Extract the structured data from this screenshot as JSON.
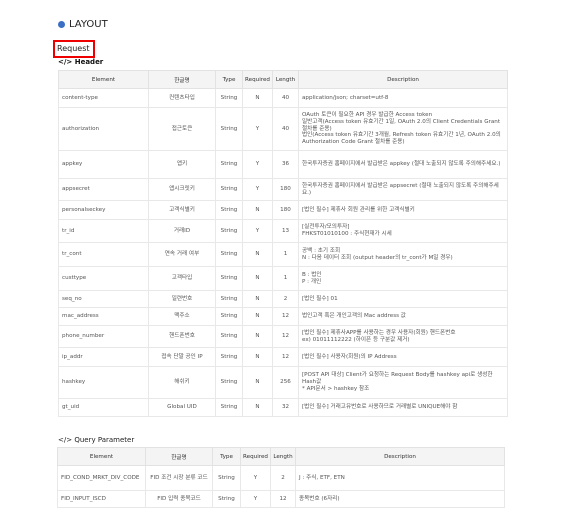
{
  "layout_title": "LAYOUT",
  "request_label": "Request",
  "header_section": "</> Header",
  "query_section": "</> Query Parameter",
  "columns": [
    "Element",
    "한글명",
    "Type",
    "Required",
    "Length",
    "Description"
  ],
  "header_rows": [
    [
      "content-type",
      "컨텐츠타입",
      "String",
      "N",
      "40",
      "application/json; charset=utf-8"
    ],
    [
      "authorization",
      "접근토큰",
      "String",
      "Y",
      "40",
      "OAuth 토큰이 필요한 API 경우 발급한 Access token\n일반고객(Access token 유효기간 1일, OAuth 2.0의 Client Credentials Grant 절차를 준용)\n법인(Access token 유효기간 3개월, Refresh token 유효기간 1년, OAuth 2.0의 Authorization Code Grant 절차를 준용)"
    ],
    [
      "appkey",
      "앱키",
      "String",
      "Y",
      "36",
      "한국투자증권 홈페이지에서 발급받은 appkey (절대 노출되지 않도록 주의해주세요.)"
    ],
    [
      "appsecret",
      "앱시크릿키",
      "String",
      "Y",
      "180",
      "한국투자증권 홈페이지에서 발급받은 appsecret (절대 노출되지 않도록 주의해주세요.)"
    ],
    [
      "personalseckey",
      "고객식별키",
      "String",
      "N",
      "180",
      "[법인 필수] 제휴사 회원 관리를 위한 고객식별키"
    ],
    [
      "tr_id",
      "거래ID",
      "String",
      "Y",
      "13",
      "[실전투자/모의투자]\nFHKST01010100 : 주식현재가 시세"
    ],
    [
      "tr_cont",
      "연속 거래 여부",
      "String",
      "N",
      "1",
      "공백 : 초기 조회\nN : 다음 데이터 조회 (output header의 tr_cont가 M일 경우)"
    ],
    [
      "custtype",
      "고객타입",
      "String",
      "N",
      "1",
      "B : 법인\nP : 개인"
    ],
    [
      "seq_no",
      "일련번호",
      "String",
      "N",
      "2",
      "[법인 필수] 01"
    ],
    [
      "mac_address",
      "맥주소",
      "String",
      "N",
      "12",
      "법인고객 혹은 개인고객의 Mac address 값"
    ],
    [
      "phone_number",
      "핸드폰번호",
      "String",
      "N",
      "12",
      "[법인 필수] 제휴사APP를 사용하는 경우 사용자(회원) 핸드폰번호\nex) 01011112222 (하이픈 등 구분값 제거)"
    ],
    [
      "ip_addr",
      "접속 단말 공인 IP",
      "String",
      "N",
      "12",
      "[법인 필수] 사용자(회원)의 IP Address"
    ],
    [
      "hashkey",
      "해쉬키",
      "String",
      "N",
      "256",
      "[POST API 대상] Client가 요청하는 Request Body를 hashkey api로 생성한 Hash값\n* API문서 > hashkey 참조"
    ],
    [
      "gt_uid",
      "Global UID",
      "String",
      "N",
      "32",
      "[법인 필수] 거래고유번호로 사용하므로 거래별로 UNIQUE해야 함"
    ]
  ],
  "query_rows": [
    [
      "FID_COND_MRKT_DIV_CODE",
      "FID 조건 시장 분류 코드",
      "String",
      "Y",
      "2",
      "J : 주식, ETF, ETN"
    ],
    [
      "FID_INPUT_ISCD",
      "FID 입력 종목코드",
      "String",
      "Y",
      "12",
      "종목번호 (6자리)"
    ]
  ]
}
